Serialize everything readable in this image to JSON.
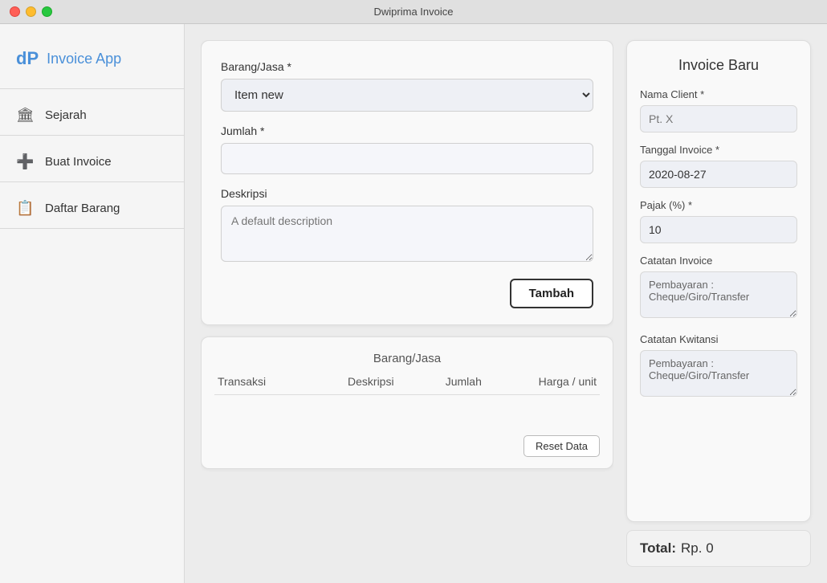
{
  "titlebar": {
    "title": "Dwiprima Invoice"
  },
  "sidebar": {
    "brand_logo": "dP",
    "brand_name": "Invoice App",
    "items": [
      {
        "id": "sejarah",
        "label": "Sejarah",
        "icon": "🏛"
      },
      {
        "id": "buat-invoice",
        "label": "Buat Invoice",
        "icon": "➕"
      },
      {
        "id": "daftar-barang",
        "label": "Daftar Barang",
        "icon": "📋"
      }
    ]
  },
  "form": {
    "barang_jasa_label": "Barang/Jasa *",
    "barang_jasa_value": "Item new",
    "jumlah_label": "Jumlah *",
    "jumlah_value": "",
    "deskripsi_label": "Deskripsi",
    "deskripsi_placeholder": "A default description",
    "tambah_btn": "Tambah"
  },
  "table": {
    "title": "Barang/Jasa",
    "headers": {
      "transaksi": "Transaksi",
      "deskripsi": "Deskripsi",
      "jumlah": "Jumlah",
      "harga_unit": "Harga / unit"
    },
    "reset_btn": "Reset Data"
  },
  "invoice": {
    "title": "Invoice Baru",
    "nama_client_label": "Nama Client *",
    "nama_client_placeholder": "Pt. X",
    "tanggal_label": "Tanggal Invoice *",
    "tanggal_value": "2020-08-27",
    "pajak_label": "Pajak (%) *",
    "pajak_value": "10",
    "catatan_invoice_label": "Catatan Invoice",
    "catatan_invoice_value": "Pembayaran :\nCheque/Giro/Transfer",
    "catatan_kwitansi_label": "Catatan Kwitansi",
    "catatan_kwitansi_value": "Pembayaran :\nCheque/Giro/Transfer",
    "total_label": "Total:",
    "total_value": "Rp. 0"
  }
}
